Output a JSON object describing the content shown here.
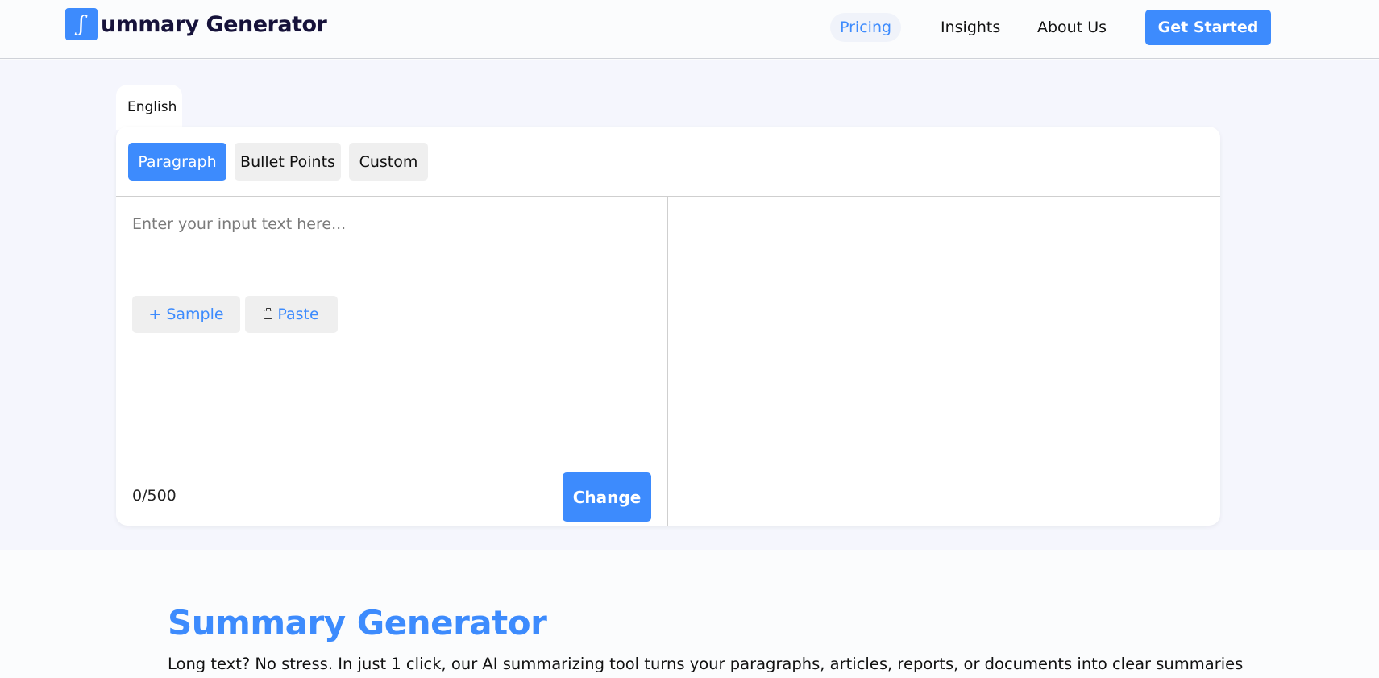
{
  "header": {
    "logo_glyph": "ʃ",
    "logo_text": "ummary Generator",
    "nav": {
      "pricing": "Pricing",
      "insights": "Insights",
      "about": "About Us"
    },
    "cta": "Get Started"
  },
  "tool": {
    "language_tab": "English",
    "modes": {
      "paragraph": "Paragraph",
      "bullets": "Bullet Points",
      "custom": "Custom"
    },
    "active_mode": "Paragraph",
    "input": {
      "placeholder": "Enter your input text here...",
      "value": ""
    },
    "sample_label": "+ Sample",
    "paste_label": "Paste",
    "counter": "0/500",
    "change_label": "Change"
  },
  "content": {
    "title": "Summary Generator",
    "description": "Long text? No stress. In just 1 click, our AI summarizing tool turns your paragraphs, articles, reports, or documents into clear summaries"
  },
  "colors": {
    "accent": "#3d8bfd",
    "band_bg": "#f5f6fd",
    "logo_text": "#16123a"
  }
}
